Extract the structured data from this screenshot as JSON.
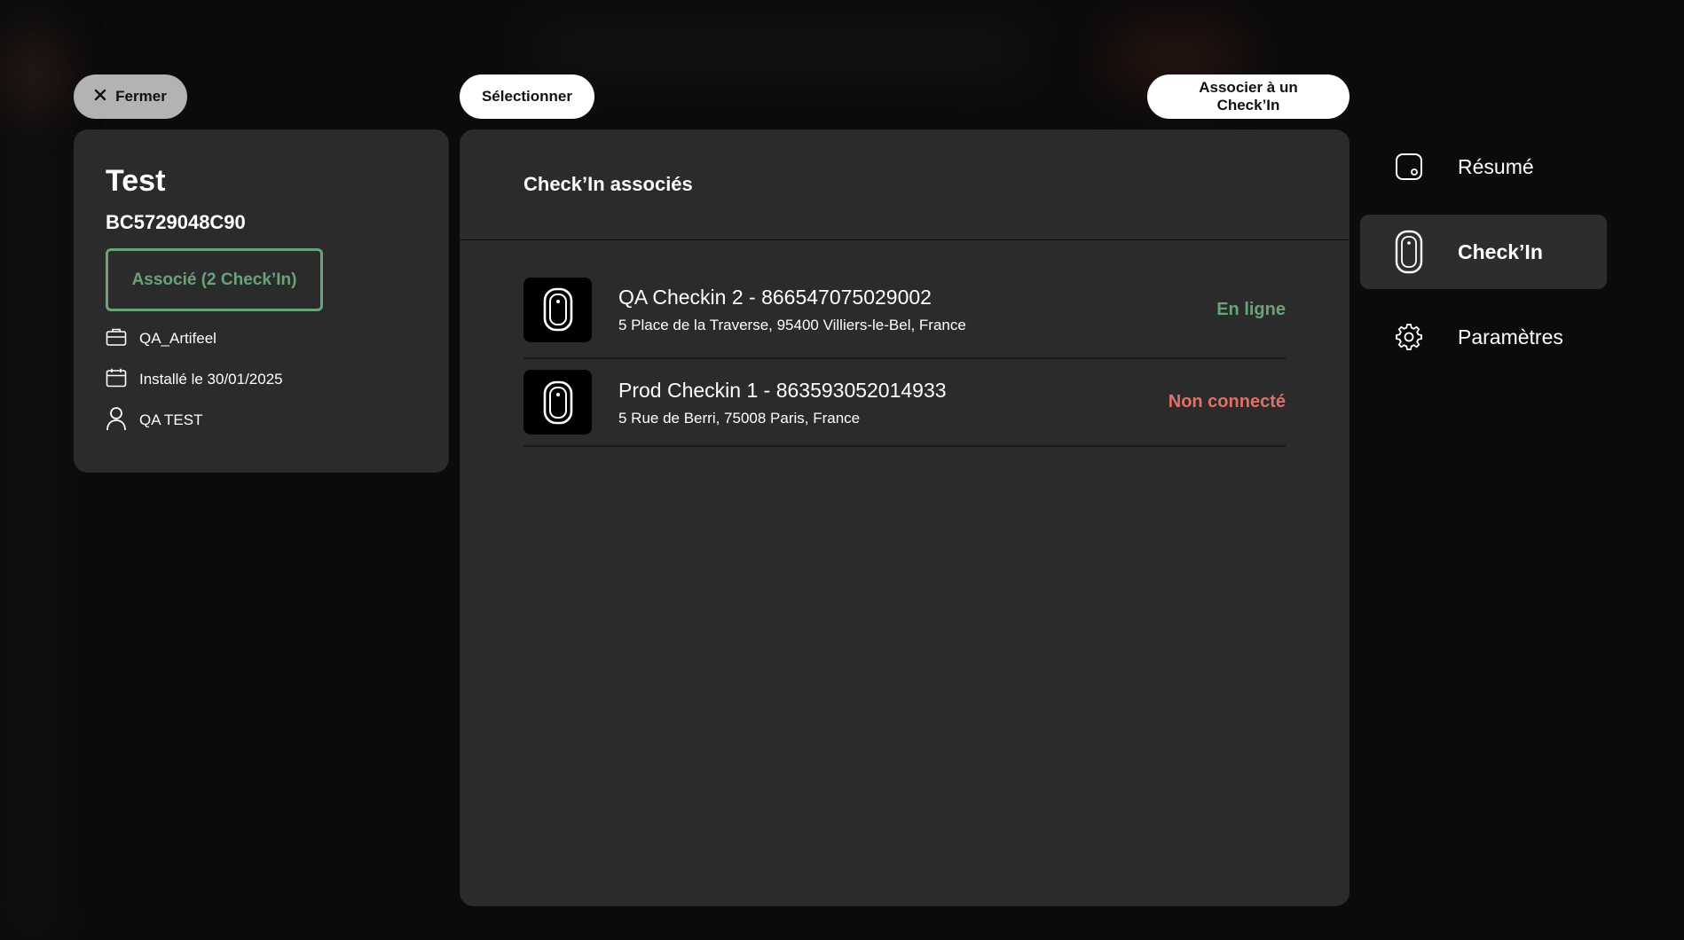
{
  "toolbar": {
    "close_label": "Fermer",
    "select_label": "Sélectionner",
    "associate_label": "Associer à un Check’In"
  },
  "device": {
    "name": "Test",
    "serial": "BC5729048C90",
    "status": "Associé (2 Check’In)",
    "organization": "QA_Artifeel",
    "installed": "Installé le 30/01/2025",
    "user": "QA TEST"
  },
  "main": {
    "title": "Check’In associés",
    "items": [
      {
        "name": "QA Checkin 2 - 866547075029002",
        "address": "5 Place de la Traverse, 95400 Villiers-le-Bel, France",
        "status": "En ligne",
        "status_color": "#6aa27a"
      },
      {
        "name": "Prod Checkin 1 - 863593052014933",
        "address": "5 Rue de Berri, 75008 Paris, France",
        "status": "Non connecté",
        "status_color": "#e0706a"
      }
    ]
  },
  "nav": {
    "items": [
      {
        "label": "Résumé",
        "icon": "summary-device-icon"
      },
      {
        "label": "Check’In",
        "icon": "checkin-device-icon",
        "active": true
      },
      {
        "label": "Paramètres",
        "icon": "gear-icon"
      }
    ]
  },
  "colors": {
    "accent_green": "#6aa27a",
    "accent_red": "#e0706a",
    "card_bg": "#2b2b2b"
  }
}
